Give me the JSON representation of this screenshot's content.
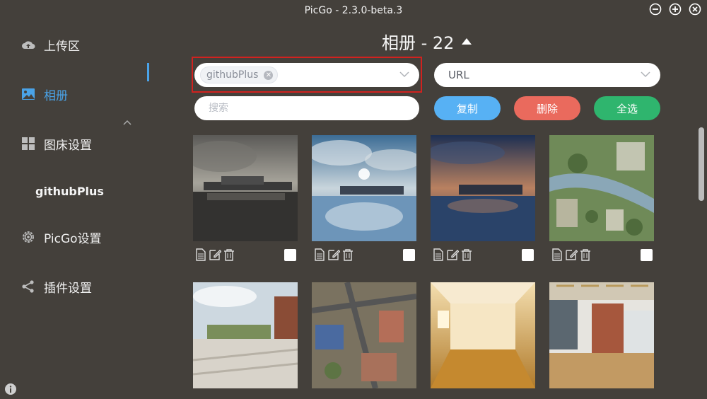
{
  "window": {
    "title": "PicGo - 2.3.0-beta.3"
  },
  "sidebar": {
    "items": [
      {
        "label": "上传区",
        "icon": "cloud-upload-icon"
      },
      {
        "label": "相册",
        "icon": "image-icon"
      },
      {
        "label": "图床设置",
        "icon": "grid-icon"
      },
      {
        "label": "githubPlus"
      },
      {
        "label": "PicGo设置",
        "icon": "gear-icon"
      },
      {
        "label": "插件设置",
        "icon": "share-icon"
      }
    ]
  },
  "gallery": {
    "title": "相册 - 22",
    "picbed_filter": {
      "selected_tag": "githubPlus"
    },
    "link_format": {
      "value": "URL"
    },
    "search": {
      "placeholder": "搜索"
    },
    "buttons": {
      "copy": "复制",
      "delete": "删除",
      "select_all": "全选"
    },
    "images": [
      {
        "scene": "dusk-building-reflection"
      },
      {
        "scene": "sky-building-reflection"
      },
      {
        "scene": "sunset-building-reflection"
      },
      {
        "scene": "aerial-masterplan"
      },
      {
        "scene": "campus-plaza"
      },
      {
        "scene": "aerial-city"
      },
      {
        "scene": "sunlit-room"
      },
      {
        "scene": "canopy-courtyard"
      }
    ]
  },
  "colors": {
    "background": "#44403b",
    "accent": "#4aa3e8",
    "copy": "#57b1f4",
    "delete": "#ea6a5d",
    "select_all": "#2fb56e",
    "highlight": "#d1221f"
  }
}
